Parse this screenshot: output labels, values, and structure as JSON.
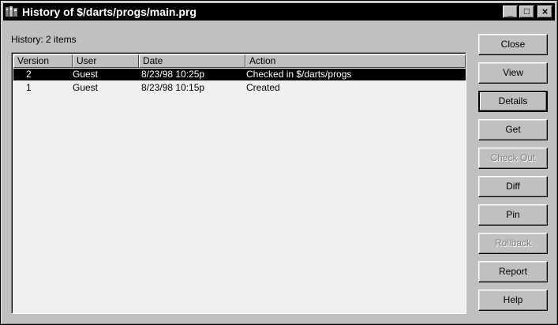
{
  "window": {
    "title": "History of $/darts/progs/main.prg",
    "controls": {
      "minimize": "_",
      "maximize": "□",
      "close": "×"
    }
  },
  "history_label": "History: 2 items",
  "columns": [
    "Version",
    "User",
    "Date",
    "Action"
  ],
  "rows": [
    {
      "version": "2",
      "user": "Guest",
      "date": "8/23/98 10:25p",
      "action": "Checked in $/darts/progs",
      "selected": true
    },
    {
      "version": "1",
      "user": "Guest",
      "date": "8/23/98 10:15p",
      "action": "Created",
      "selected": false
    }
  ],
  "buttons": [
    {
      "label": "Close",
      "enabled": true
    },
    {
      "label": "View",
      "enabled": true
    },
    {
      "label": "Details",
      "enabled": true,
      "focused": true
    },
    {
      "label": "Get",
      "enabled": true
    },
    {
      "label": "Check Out",
      "enabled": false
    },
    {
      "label": "Diff",
      "enabled": true
    },
    {
      "label": "Pin",
      "enabled": true
    },
    {
      "label": "Rollback",
      "enabled": false
    },
    {
      "label": "Report",
      "enabled": true
    },
    {
      "label": "Help",
      "enabled": true
    }
  ]
}
